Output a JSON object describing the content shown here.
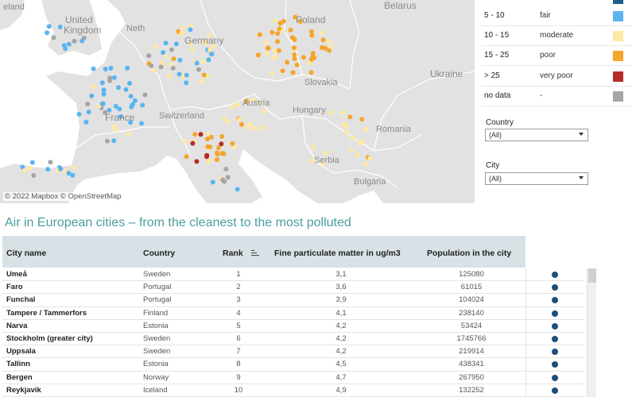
{
  "map": {
    "labels": [
      {
        "key": "ireland_fragment",
        "text": "eland"
      },
      {
        "key": "united_kingdom_1",
        "text": "United"
      },
      {
        "key": "united_kingdom_2",
        "text": "Kingdom"
      },
      {
        "key": "netherlands",
        "text": "Neth"
      },
      {
        "key": "germany",
        "text": "Germany"
      },
      {
        "key": "poland",
        "text": "Poland"
      },
      {
        "key": "belarus",
        "text": "Belarus"
      },
      {
        "key": "ukraine",
        "text": "Ukraine"
      },
      {
        "key": "slovakia",
        "text": "Slovakia"
      },
      {
        "key": "france",
        "text": "France"
      },
      {
        "key": "switzerland",
        "text": "Switzerland"
      },
      {
        "key": "austria",
        "text": "Austria"
      },
      {
        "key": "hungary",
        "text": "Hungary"
      },
      {
        "key": "romania",
        "text": "Romania"
      },
      {
        "key": "serbia",
        "text": "Serbia"
      },
      {
        "key": "bulgaria",
        "text": "Bulgaria"
      }
    ],
    "attribution": "© 2022 Mapbox © OpenStreetMap",
    "colors": {
      "good": "#1f5c8a",
      "fair": "#5ab4f0",
      "moderate": "#fde9a3",
      "poor": "#f4a52a",
      "very_poor": "#b82a2a",
      "no_data": "#a5a5a5",
      "land": "#e2e2e2",
      "border": "#ffffff",
      "sea": "#ffffff"
    }
  },
  "legend": {
    "rows": [
      {
        "range": "5 - 10",
        "quality": "fair",
        "color": "#5ab4f0"
      },
      {
        "range": "10 - 15",
        "quality": "moderate",
        "color": "#fde9a3"
      },
      {
        "range": "15 - 25",
        "quality": "poor",
        "color": "#f4a52a"
      },
      {
        "range": "> 25",
        "quality": "very poor",
        "color": "#b82a2a"
      },
      {
        "range": "no data",
        "quality": "-",
        "color": "#a5a5a5"
      }
    ]
  },
  "filters": {
    "country": {
      "label": "Country",
      "value": "(All)"
    },
    "city": {
      "label": "City",
      "value": "(All)"
    }
  },
  "title": "Air in European cities – from the cleanest to the most polluted",
  "table": {
    "headers": {
      "city": "City name",
      "country": "Country",
      "rank": "Rank",
      "pm": "Fine particulate matter in ug/m3",
      "population": "Population in the city"
    },
    "dot_color": "#1f4e79",
    "rows": [
      {
        "city": "Umeå",
        "country": "Sweden",
        "rank": "1",
        "pm": "3,1",
        "population": "125080"
      },
      {
        "city": "Faro",
        "country": "Portugal",
        "rank": "2",
        "pm": "3,6",
        "population": "61015"
      },
      {
        "city": "Funchal",
        "country": "Portugal",
        "rank": "3",
        "pm": "3,9",
        "population": "104024"
      },
      {
        "city": "Tampere / Tammerfors",
        "country": "Finland",
        "rank": "4",
        "pm": "4,1",
        "population": "238140"
      },
      {
        "city": "Narva",
        "country": "Estonia",
        "rank": "5",
        "pm": "4,2",
        "population": "53424"
      },
      {
        "city": "Stockholm (greater city)",
        "country": "Sweden",
        "rank": "6",
        "pm": "4,2",
        "population": "1745766"
      },
      {
        "city": "Uppsala",
        "country": "Sweden",
        "rank": "7",
        "pm": "4,2",
        "population": "219914"
      },
      {
        "city": "Tallinn",
        "country": "Estonia",
        "rank": "8",
        "pm": "4,5",
        "population": "438341"
      },
      {
        "city": "Bergen",
        "country": "Norway",
        "rank": "9",
        "pm": "4,7",
        "population": "267950"
      },
      {
        "city": "Reykjavik",
        "country": "Iceland",
        "rank": "10",
        "pm": "4,9",
        "population": "132252"
      }
    ]
  }
}
